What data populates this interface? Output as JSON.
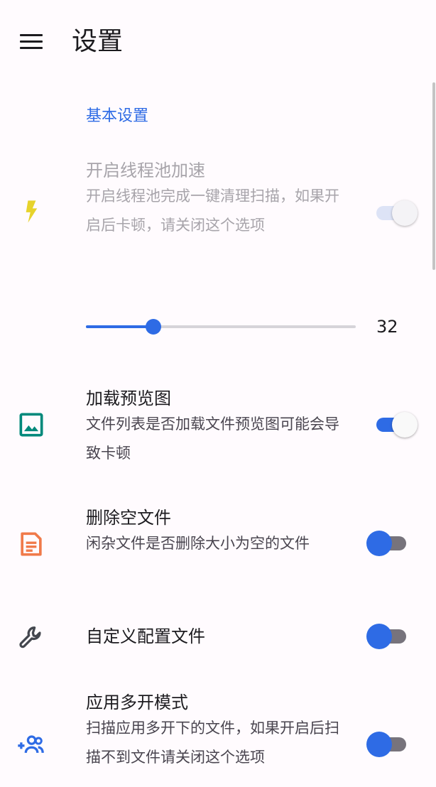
{
  "app_bar": {
    "title": "设置",
    "menu_icon": "menu-icon"
  },
  "section": {
    "title": "基本设置"
  },
  "accent_color": "#2E6BE5",
  "settings": [
    {
      "key": "thread_pool",
      "icon": "flash-icon",
      "title": "开启线程池加速",
      "summary": "开启线程池完成一键清理扫描，如果开启后卡顿，请关闭这个选项",
      "checked": true,
      "enabled": false
    },
    {
      "key": "load_preview",
      "icon": "image-icon",
      "title": "加载预览图",
      "summary": "文件列表是否加载文件预览图可能会导致卡顿",
      "checked": true,
      "enabled": true
    },
    {
      "key": "delete_empty",
      "icon": "document-icon",
      "title": "删除空文件",
      "summary": "闲杂文件是否删除大小为空的文件",
      "checked": false,
      "enabled": true
    },
    {
      "key": "custom_config",
      "icon": "wrench-icon",
      "title": "自定义配置文件",
      "checked": false,
      "enabled": true
    },
    {
      "key": "multi_app",
      "icon": "group-add-icon",
      "title": "应用多开模式",
      "summary": "扫描应用多开下的文件，如果开启后扫描不到文件请关闭这个选项",
      "checked": false,
      "enabled": true
    }
  ],
  "thread_slider": {
    "value": 32,
    "min": 0,
    "max": 128,
    "value_label": "32"
  }
}
